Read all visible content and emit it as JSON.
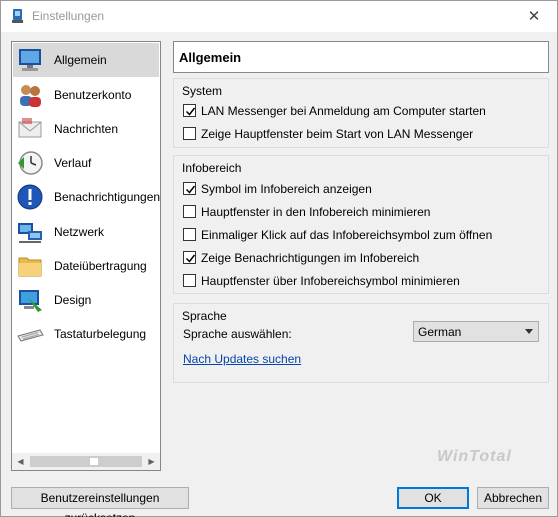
{
  "window": {
    "title": "Einstellungen",
    "close_symbol": "✕"
  },
  "sidebar": {
    "items": [
      {
        "label": "Allgemein",
        "icon": "monitor-icon",
        "selected": true
      },
      {
        "label": "Benutzerkonto",
        "icon": "users-icon",
        "selected": false
      },
      {
        "label": "Nachrichten",
        "icon": "envelope-icon",
        "selected": false
      },
      {
        "label": "Verlauf",
        "icon": "clock-icon",
        "selected": false
      },
      {
        "label": "Benachrichtigungen",
        "icon": "info-icon",
        "selected": false
      },
      {
        "label": "Netzwerk",
        "icon": "network-icon",
        "selected": false
      },
      {
        "label": "Dateiübertragung",
        "icon": "folder-icon",
        "selected": false
      },
      {
        "label": "Design",
        "icon": "palette-icon",
        "selected": false
      },
      {
        "label": "Tastaturbelegung",
        "icon": "keyboard-icon",
        "selected": false
      }
    ],
    "scroll_left": "◀",
    "scroll_right": "▶"
  },
  "panel": {
    "header": "Allgemein",
    "system": {
      "title": "System",
      "options": [
        {
          "label": "LAN Messenger bei Anmeldung am Computer starten",
          "checked": true
        },
        {
          "label": "Zeige Hauptfenster beim Start von LAN Messenger",
          "checked": false
        }
      ]
    },
    "tray": {
      "title": "Infobereich",
      "options": [
        {
          "label": "Symbol im Infobereich anzeigen",
          "checked": true
        },
        {
          "label": "Hauptfenster in den Infobereich minimieren",
          "checked": false
        },
        {
          "label": "Einmaliger Klick auf das Infobereichsymbol zum öffnen",
          "checked": false
        },
        {
          "label": "Zeige Benachrichtigungen im Infobereich",
          "checked": true
        },
        {
          "label": "Hauptfenster über Infobereichsymbol minimieren",
          "checked": false
        }
      ]
    },
    "language": {
      "title": "Sprache",
      "select_label": "Sprache auswählen:",
      "selected": "German",
      "updates_link": "Nach Updates suchen"
    }
  },
  "footer": {
    "reset_label": "Benutzereinstellungen zurücksetzen",
    "ok_label": "OK",
    "cancel_label": "Abbrechen",
    "watermark": "WinTotal"
  },
  "colors": {
    "accent": "#0078d7",
    "link": "#0645ad",
    "selection": "#d9d9d9"
  }
}
